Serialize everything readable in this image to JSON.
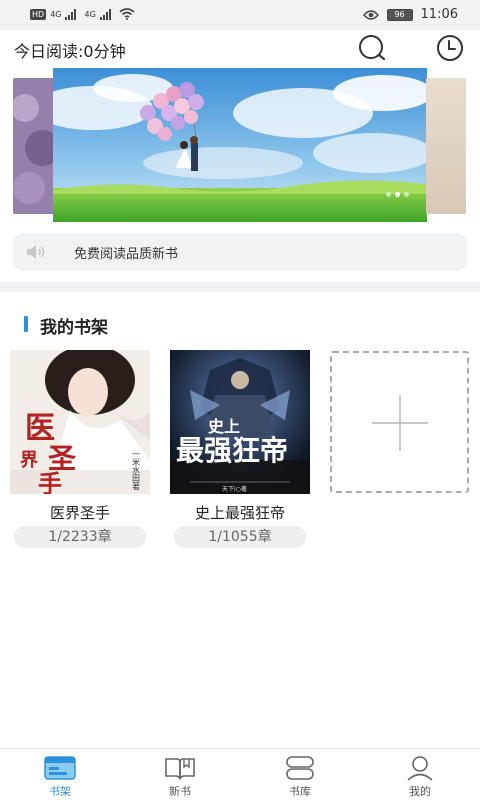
{
  "status_bar": {
    "left": "HD",
    "net1": "4G",
    "net2": "4G",
    "battery": "96",
    "time": "11:06"
  },
  "header": {
    "reading_today": "今日阅读:0分钟"
  },
  "notice": {
    "text": "免费阅读品质新书"
  },
  "shelf": {
    "title": "我的书架",
    "books": [
      {
        "title": "医界圣手",
        "progress": "1/2233章",
        "cover_text": "医界圣手",
        "cover_author": "一米水田著"
      },
      {
        "title": "史上最强狂帝",
        "progress": "1/1055章",
        "cover_text_small": "史上",
        "cover_text_big": "最强狂帝",
        "cover_author": "天下I○著"
      }
    ]
  },
  "nav": {
    "items": [
      {
        "label": "书架",
        "active": true
      },
      {
        "label": "新书",
        "active": false
      },
      {
        "label": "书库",
        "active": false
      },
      {
        "label": "我的",
        "active": false
      }
    ],
    "accent": "#2e92db"
  }
}
